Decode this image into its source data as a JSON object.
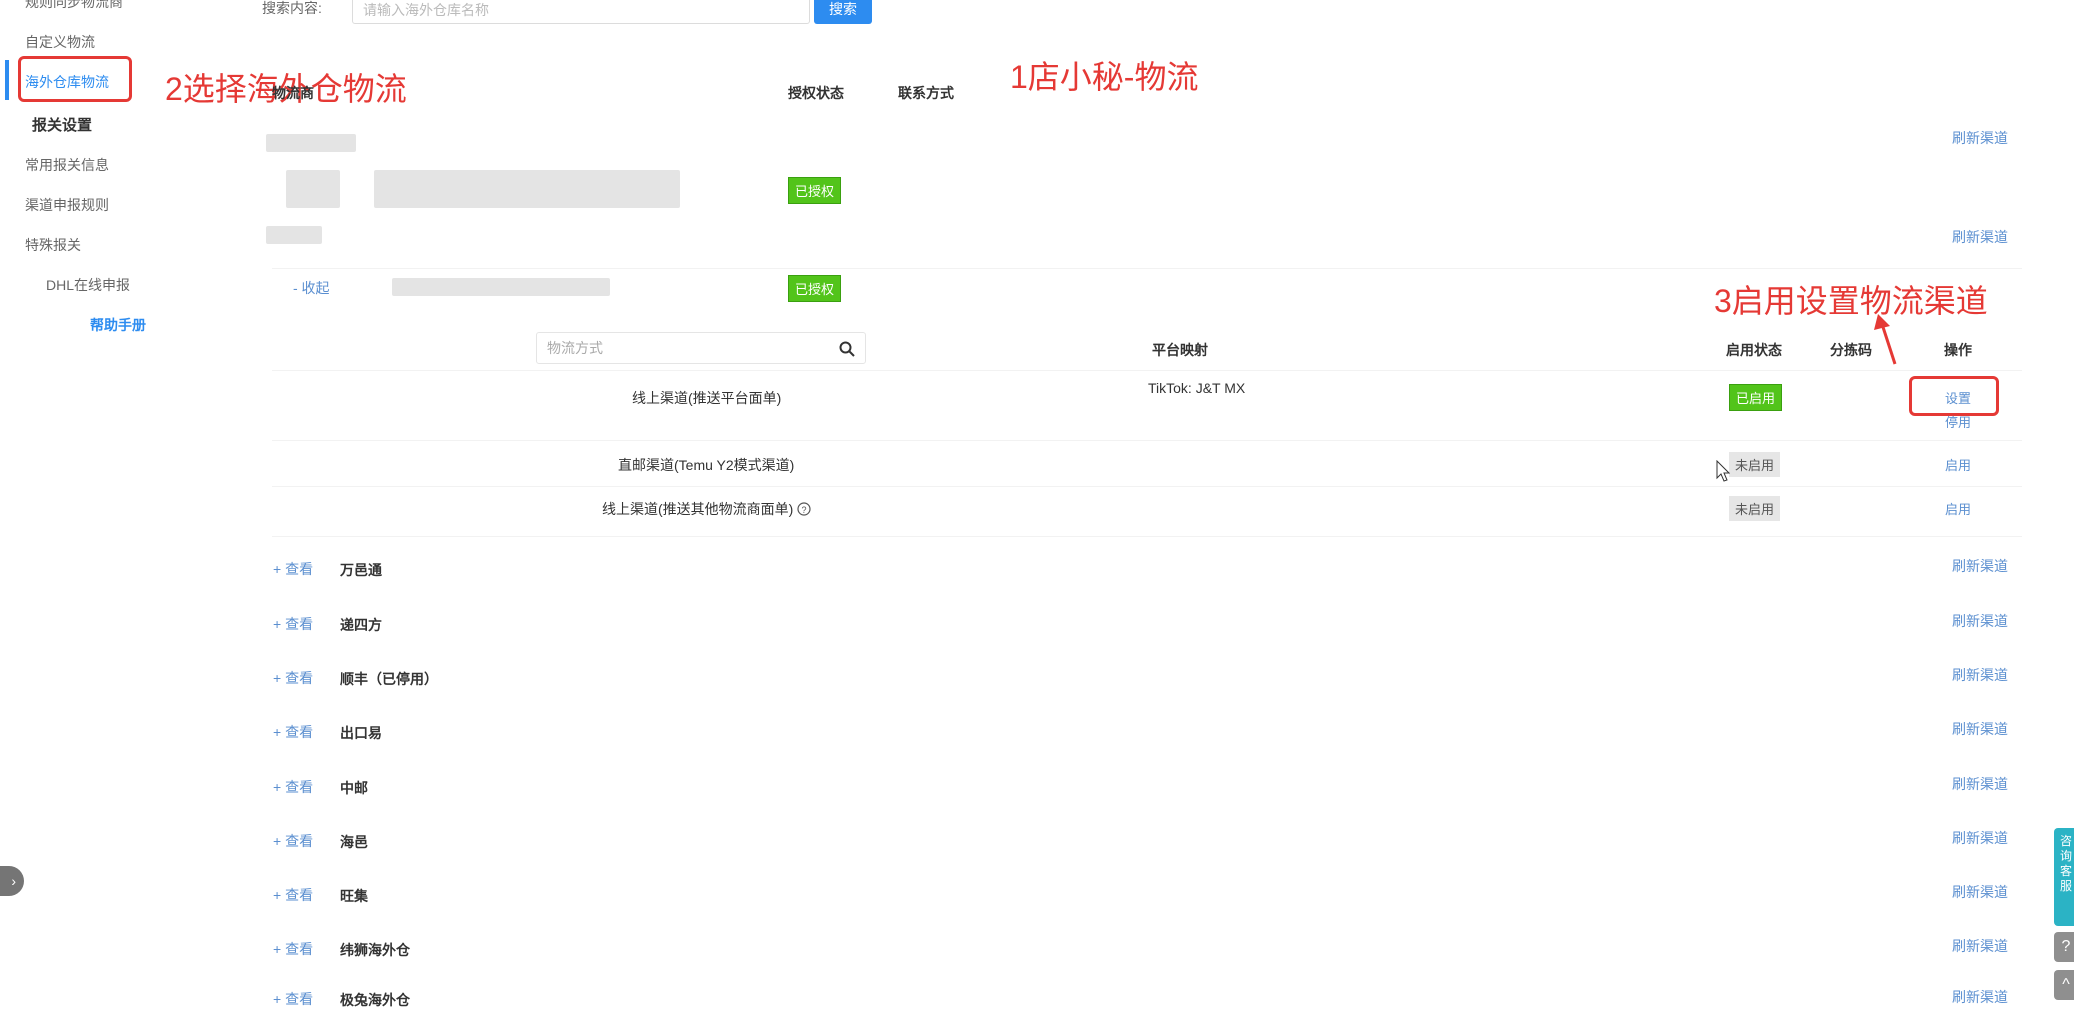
{
  "sidebar": {
    "items": [
      {
        "label": "规则同步物流商"
      },
      {
        "label": "自定义物流"
      },
      {
        "label": "海外仓库物流"
      },
      {
        "label": "报关设置"
      },
      {
        "label": "常用报关信息"
      },
      {
        "label": "渠道申报规则"
      },
      {
        "label": "特殊报关"
      },
      {
        "label": "DHL在线申报"
      }
    ],
    "help": "帮助手册"
  },
  "annotations": {
    "step1": "1店小秘-物流",
    "step2": "2选择海外仓物流",
    "step3": "3启用设置物流渠道"
  },
  "search": {
    "label": "搜索内容:",
    "placeholder": "请输入海外仓库名称",
    "button": "搜索"
  },
  "table": {
    "headers": {
      "provider": "物流商",
      "auth": "授权状态",
      "contact": "联系方式"
    },
    "refresh": "刷新渠道",
    "authorized": "已授权",
    "collapse": "- 收起",
    "expand": "+ 查看"
  },
  "subtable": {
    "search_placeholder": "物流方式",
    "headers": {
      "mapping": "平台映射",
      "status": "启用状态",
      "code": "分拣码",
      "ops": "操作"
    },
    "rows": [
      {
        "name": "线上渠道(推送平台面单)",
        "mapping": "TikTok:   J&T MX",
        "status": "已启用",
        "op1": "设置",
        "op2": "停用"
      },
      {
        "name": "直邮渠道(Temu Y2模式渠道)",
        "status": "未启用",
        "op1": "启用"
      },
      {
        "name": "线上渠道(推送其他物流商面单)",
        "status": "未启用",
        "op1": "启用"
      }
    ]
  },
  "providers": [
    {
      "name": "万邑通"
    },
    {
      "name": "递四方"
    },
    {
      "name": "顺丰（已停用）"
    },
    {
      "name": "出口易"
    },
    {
      "name": "中邮"
    },
    {
      "name": "海邑"
    },
    {
      "name": "旺集"
    },
    {
      "name": "纬狮海外仓"
    },
    {
      "name": "极兔海外仓"
    }
  ],
  "float": {
    "consult": "咨询客服",
    "help": "?",
    "top": "^"
  },
  "toggle": "›"
}
